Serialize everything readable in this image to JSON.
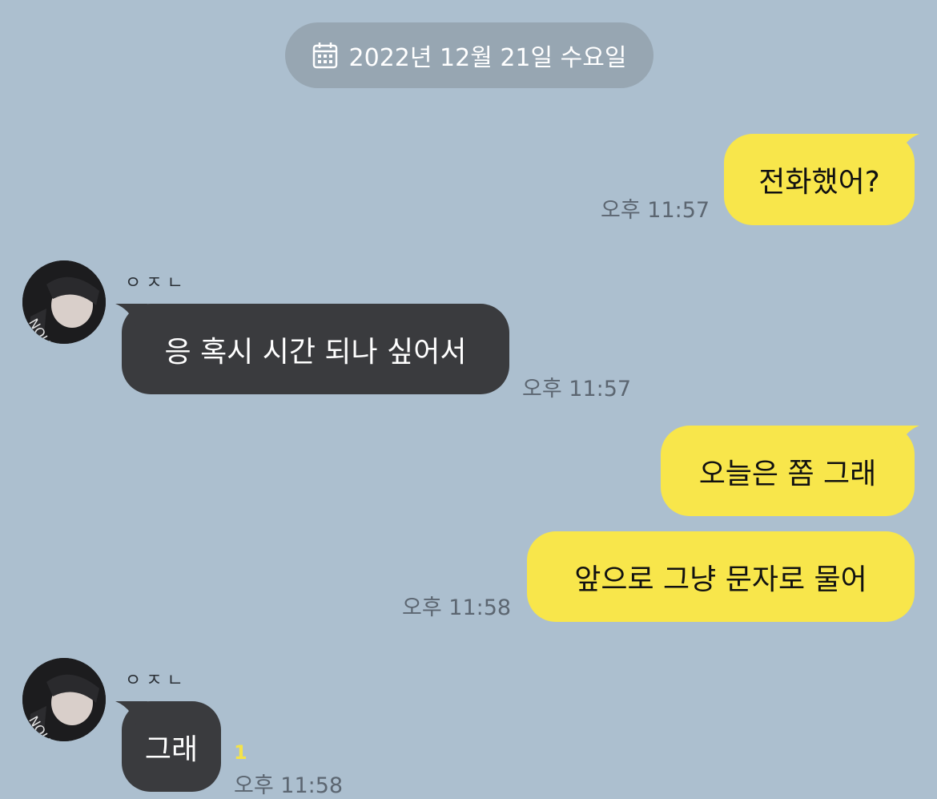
{
  "date_divider": {
    "icon": "calendar-icon",
    "label": "2022년 12월 21일 수요일"
  },
  "messages": [
    {
      "from": "me",
      "text": "전화했어?",
      "time": "오후 11:57"
    },
    {
      "from": "them",
      "sender": "ㅇㅈㄴ",
      "text": "응 혹시 시간 되나 싶어서",
      "time": "오후 11:57"
    },
    {
      "from": "me",
      "text": "오늘은 쫌 그래",
      "time": ""
    },
    {
      "from": "me",
      "text": "앞으로 그냥 문자로 물어",
      "time": "오후 11:58"
    },
    {
      "from": "them",
      "sender": "ㅇㅈㄴ",
      "text": "그래",
      "time": "오후 11:58",
      "unread": "1"
    }
  ],
  "colors": {
    "background": "#acbfcf",
    "my_bubble": "#f8e64b",
    "their_bubble": "#3a3b3e",
    "date_pill": "#97a6b2",
    "unread": "#f4e34a"
  }
}
